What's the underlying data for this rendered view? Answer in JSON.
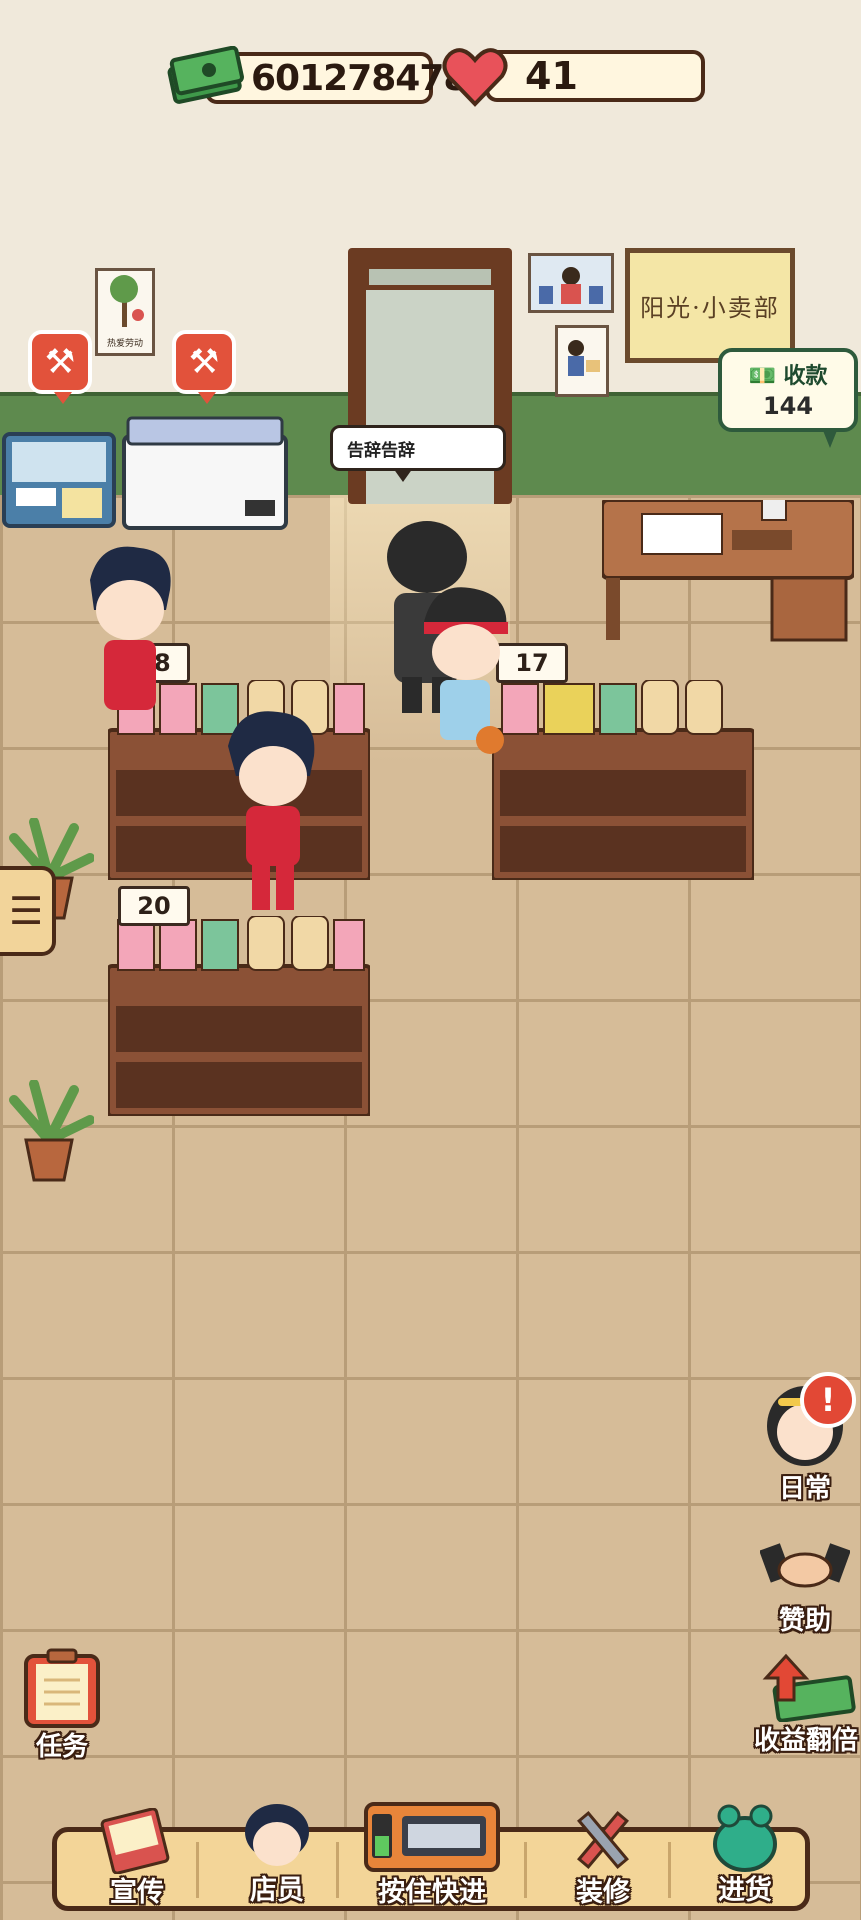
{
  "hud": {
    "money": "601278478",
    "hearts": "41"
  },
  "wall": {
    "shop_sign": "阳光·小卖部",
    "poster_caption": "热爱劳动"
  },
  "speech": {
    "farewell": "告辞告辞"
  },
  "register": {
    "label": "收款",
    "amount": "144"
  },
  "shelves": [
    {
      "stock": "18"
    },
    {
      "stock": "17"
    },
    {
      "stock": "20"
    }
  ],
  "side_buttons": {
    "daily": "日常",
    "sponsor": "赞助",
    "double_income": "收益翻倍",
    "tasks": "任务",
    "alert": "!"
  },
  "bottom_nav": {
    "promo": "宣传",
    "staff": "店员",
    "fast_forward": "按住快进",
    "renovate": "装修",
    "restock": "进货"
  },
  "icons": {
    "money": "cash-stack-icon",
    "hearts": "heart-icon",
    "repair": "hammer-wrench-icon",
    "menu": "list-icon"
  },
  "colors": {
    "wall": "#f0e9db",
    "trim": "#5e8a4e",
    "floor": "#d6bc98",
    "bar": "#f3d598",
    "alert": "#e24835"
  }
}
